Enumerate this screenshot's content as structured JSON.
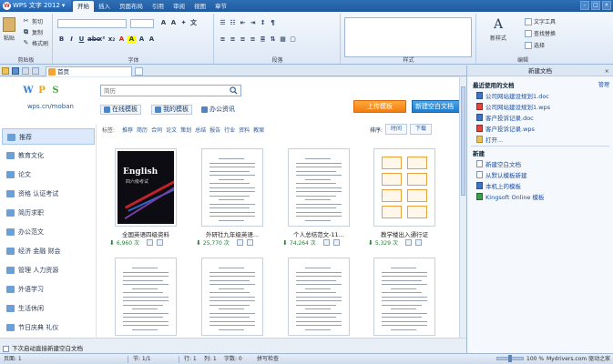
{
  "app": {
    "title": "WPS 文字 2012",
    "menu_tabs": [
      "开始",
      "插入",
      "页面布局",
      "引用",
      "审阅",
      "视图",
      "章节"
    ]
  },
  "ribbon": {
    "clipboard": {
      "paste": "粘贴",
      "cut": "剪切",
      "copy": "复制",
      "format_painter": "格式刷",
      "label": "剪贴板"
    },
    "font": {
      "label": "字体"
    },
    "paragraph": {
      "label": "段落"
    },
    "styles": {
      "label": "样式"
    },
    "editing": {
      "new_style": "新样式",
      "text_tools": "文字工具",
      "find_replace": "查找替换",
      "select": "选择",
      "label": "编辑"
    }
  },
  "doc_tab": {
    "label": "首页"
  },
  "brand": {
    "url": "wps.cn/moban"
  },
  "search": {
    "placeholder": "简历"
  },
  "top_links": {
    "online": "在线模板",
    "mine": "我的模板",
    "office": "办公资讯"
  },
  "buttons": {
    "upload": "上传模板",
    "new_blank": "新建空白文档"
  },
  "categories": {
    "label": "标签:",
    "items": [
      "推荐",
      "简历",
      "合同",
      "论文",
      "策划",
      "总结",
      "报告",
      "行业",
      "资料",
      "教案"
    ]
  },
  "sort": {
    "label": "排序:",
    "options": [
      "时间",
      "下载"
    ]
  },
  "left_nav": [
    {
      "label": "推荐",
      "active": true
    },
    {
      "label": "教育文化"
    },
    {
      "label": "论文"
    },
    {
      "label": "资格 认证考试"
    },
    {
      "label": "简历求职"
    },
    {
      "label": "办公范文"
    },
    {
      "label": "经济 金融 财会"
    },
    {
      "label": "管理 人力资源"
    },
    {
      "label": "外语学习"
    },
    {
      "label": "生活休闲"
    },
    {
      "label": "节日庆典 礼仪"
    }
  ],
  "templates": [
    {
      "title": "全国英语四级资料",
      "downloads": "6,960 次",
      "cover_title": "English",
      "cover_sub": "四六级考试"
    },
    {
      "title": "外研社九年级英语...",
      "downloads": "25,770 次"
    },
    {
      "title": "个人总结范文-11...",
      "downloads": "74,264 次"
    },
    {
      "title": "教学楼出入通行证",
      "downloads": "5,329 次"
    },
    {
      "title": "",
      "downloads": ""
    },
    {
      "title": "",
      "downloads": ""
    },
    {
      "title": "",
      "downloads": ""
    },
    {
      "title": "",
      "downloads": ""
    }
  ],
  "startup_checkbox": {
    "label": "下次启动直接新建空白文档"
  },
  "task_pane": {
    "header": "新建文档",
    "recent_title": "最近使用的文档",
    "more": "管理",
    "recent_docs": [
      "公司网站建设规划1.doc",
      "公司网站建设规划1.wps",
      "客户投诉记录.doc",
      "客户投诉记录.wps"
    ],
    "open": "打开...",
    "new_title": "新建",
    "new_items": [
      "新建空白文档",
      "从默认模板新建",
      "本机上的模板",
      "Kingsoft Online 模板"
    ]
  },
  "status": {
    "page": "页面: 1",
    "section": "节: 1/1",
    "row": "行: 1",
    "col": "列: 1",
    "words": "字数: 0",
    "spell": "拼写检查",
    "zoom": "100 %",
    "watermark": "Mydrivers.com 驱动之家"
  }
}
